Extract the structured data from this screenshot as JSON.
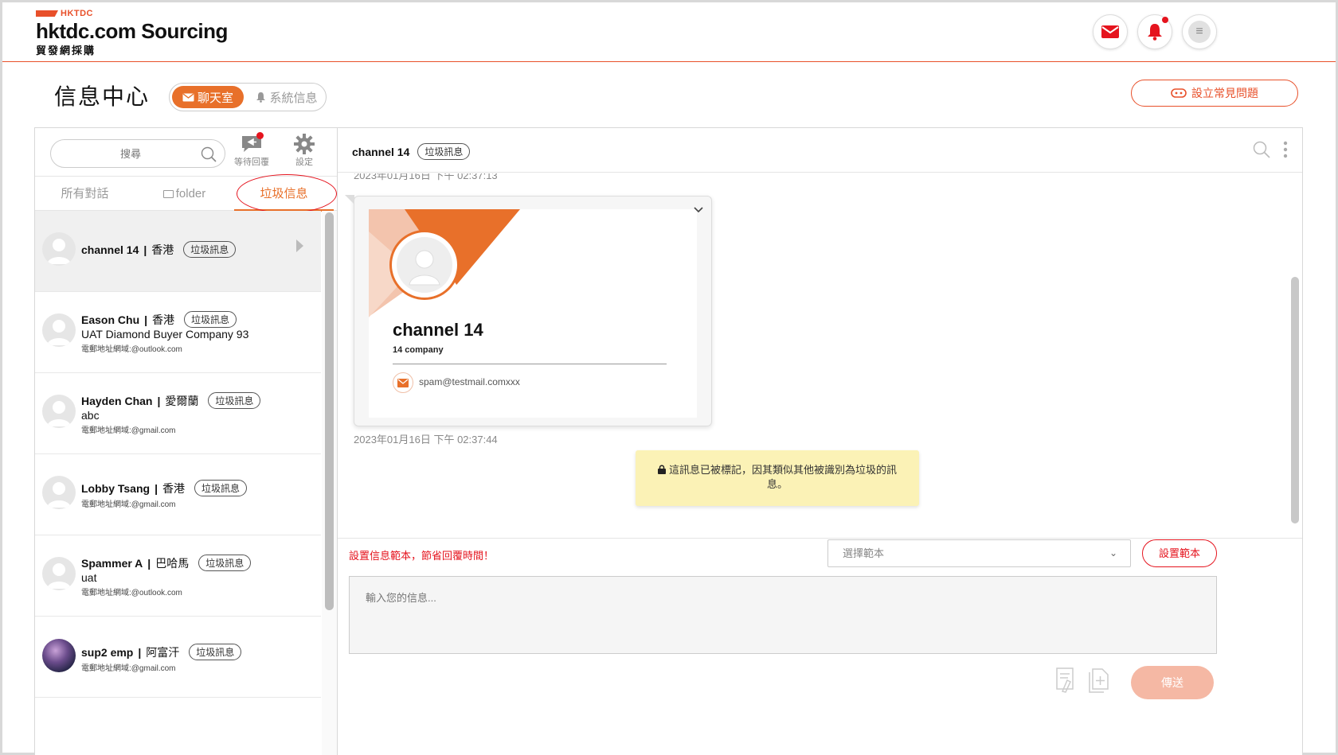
{
  "header": {
    "logo_brand": "HKTDC",
    "logo_title": "hktdc.com Sourcing",
    "logo_subtitle": "貿發網採購",
    "icons": [
      "mail-icon",
      "bell-icon",
      "menu-icon"
    ],
    "accent_color": "#e8502a"
  },
  "page": {
    "title": "信息中心",
    "tab_chat": "聊天室",
    "tab_system": "系統信息",
    "faq_button": "設立常見問題"
  },
  "sidebar": {
    "search_placeholder": "搜尋",
    "waiting_reply": "等待回覆",
    "settings": "設定",
    "filter_all": "所有對話",
    "filter_folder": "folder",
    "filter_spam": "垃圾信息",
    "conversations": [
      {
        "name": "channel 14",
        "location": "香港",
        "tag": "垃圾訊息",
        "company": "",
        "email": "",
        "selected": true
      },
      {
        "name": "Eason Chu",
        "location": "香港",
        "tag": "垃圾訊息",
        "company": "UAT Diamond Buyer Company 93",
        "email": "電郵地址網域:@outlook.com"
      },
      {
        "name": "Hayden Chan",
        "location": "愛爾蘭",
        "tag": "垃圾訊息",
        "company": "abc",
        "email": "電郵地址網域:@gmail.com"
      },
      {
        "name": "Lobby Tsang",
        "location": "香港",
        "tag": "垃圾訊息",
        "company": "",
        "email": "電郵地址網域:@gmail.com"
      },
      {
        "name": "Spammer A",
        "location": "巴哈馬",
        "tag": "垃圾訊息",
        "company": "uat",
        "email": "電郵地址網域:@outlook.com"
      },
      {
        "name": "sup2 emp",
        "location": "阿富汗",
        "tag": "垃圾訊息",
        "company": "",
        "email": "電郵地址網域:@gmail.com"
      }
    ]
  },
  "chat": {
    "title": "channel 14",
    "tag": "垃圾訊息",
    "timestamp_top": "2023年01月16日 下午 02:37:13",
    "card": {
      "name": "channel 14",
      "company": "14 company",
      "email": "spam@testmail.comxxx"
    },
    "timestamp": "2023年01月16日 下午 02:37:44",
    "spam_notice": "這訊息已被標記，因其類似其他被識別為垃圾的訊息。",
    "template_hint": "設置信息範本，節省回覆時間！",
    "template_select": "選擇範本",
    "template_button": "設置範本",
    "input_placeholder": "輸入您的信息...",
    "send_button": "傳送"
  }
}
